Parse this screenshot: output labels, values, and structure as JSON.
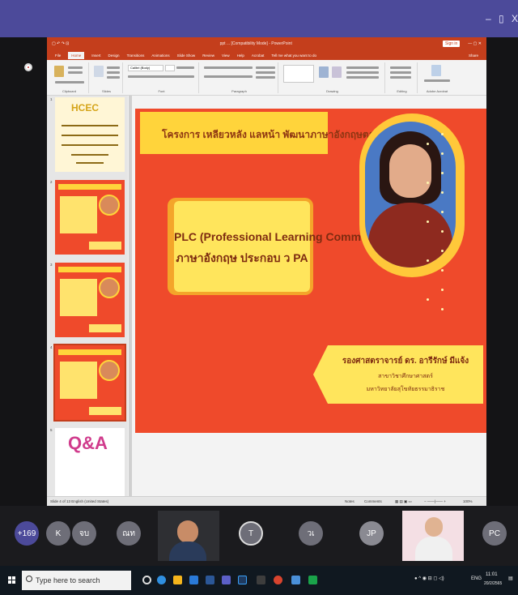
{
  "window": {
    "minimize": "–",
    "maximize": "▯",
    "close": "X"
  },
  "ppt": {
    "filename": "ppt ... [Compatibility Mode] - PowerPoint",
    "sign_in": "Sign in",
    "tabs": [
      "File",
      "Home",
      "Insert",
      "Design",
      "Transitions",
      "Animations",
      "Slide Show",
      "Review",
      "View",
      "Help",
      "Acrobat",
      "Tell me what you want to do"
    ],
    "share": "Share",
    "ribbon_groups": [
      "Clipboard",
      "Slides",
      "Font",
      "Paragraph",
      "Drawing",
      "Editing",
      "Adobe Acrobat"
    ],
    "font_name": "Calibri (Body)",
    "status": "Slide 4 of 13   English (United States)",
    "notes": "Notes",
    "comments": "Comments",
    "zoom": "100%"
  },
  "thumbnails": {
    "numbers": [
      "1",
      "2",
      "3",
      "4",
      "5"
    ],
    "logo": "HCEC",
    "qa": "Q&A"
  },
  "slide": {
    "banner": "โครงการ เหลียวหลัง แลหน้า พัฒนาภาษาอังกฤษตามเกณฑ์ CEFR",
    "main_line1": "PLC (Professional Learning Community)",
    "main_line2": "ภาษาอังกฤษ ประกอบ ว PA",
    "name_main": "รองศาสตราจารย์ ดร. อารีรักษ์ มีแจ้ง",
    "name_sub1": "สาขาวิชาศึกษาศาสตร์",
    "name_sub2": "มหาวิทยาลัยสุโขทัยธรรมาธิราช"
  },
  "participants": {
    "more": "+169",
    "avatars": [
      {
        "initials": "K",
        "color": "#6e6e78"
      },
      {
        "initials": "จบ",
        "color": "#6e6e78"
      },
      {
        "initials": "ณท",
        "color": "#6e6e78"
      },
      {
        "initials": "T",
        "color": "#6e6e78"
      },
      {
        "initials": "วเ",
        "color": "#6e6e78"
      },
      {
        "initials": "JP",
        "color": "#8a8a92"
      },
      {
        "initials": "PC",
        "color": "#6e6e78"
      }
    ]
  },
  "taskbar": {
    "search_placeholder": "Type here to search",
    "lang": "ENG",
    "time": "11:01",
    "date": "20/2/2565"
  },
  "colors": {
    "accent": "#4c4a9a",
    "ppt_red": "#c43e1c",
    "slide_bg": "#ef4a2b",
    "slide_yellow": "#ffe55c"
  }
}
